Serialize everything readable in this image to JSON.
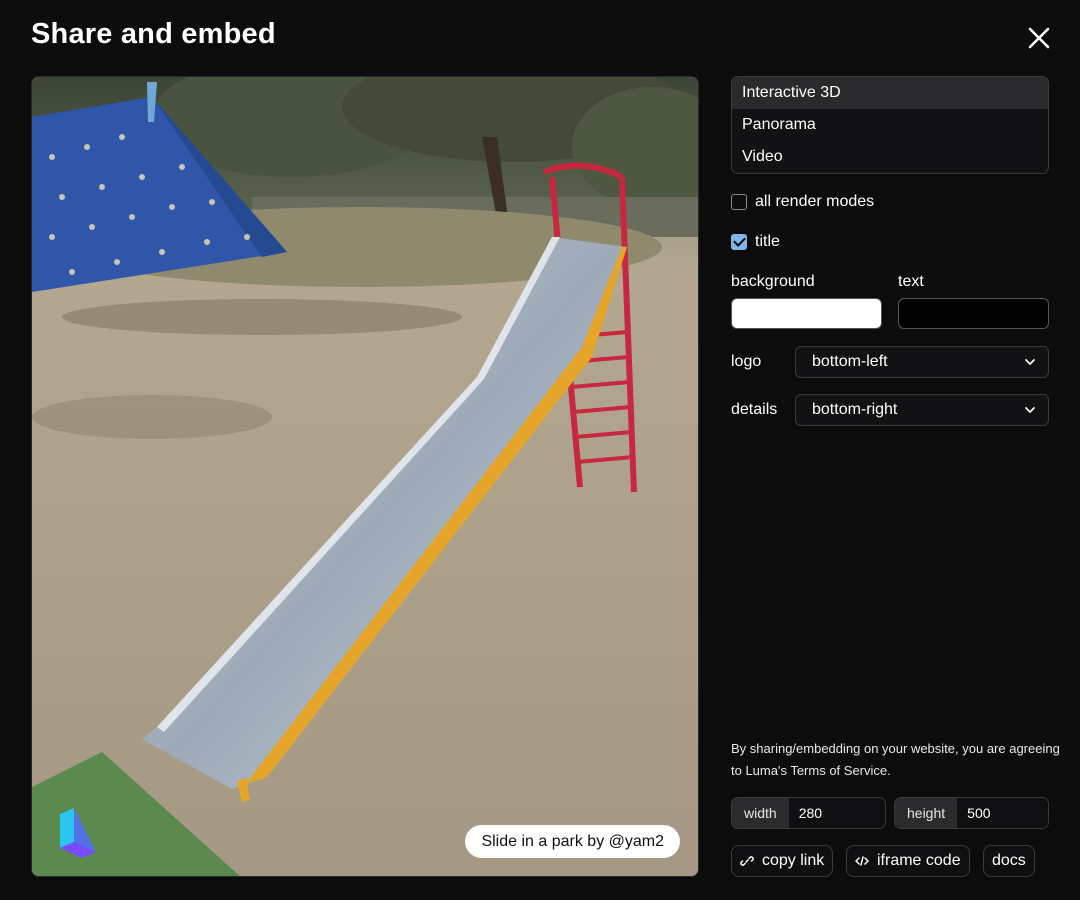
{
  "dialog": {
    "title": "Share and embed",
    "close_icon": "close-icon"
  },
  "preview": {
    "caption": "Slide in a park by @yam2",
    "logo_icon": "luma-logo-icon"
  },
  "render_modes": {
    "items": [
      {
        "label": "Interactive 3D",
        "active": true
      },
      {
        "label": "Panorama",
        "active": false
      },
      {
        "label": "Video",
        "active": false
      }
    ]
  },
  "options": {
    "all_render_modes": {
      "label": "all render modes",
      "checked": false
    },
    "title": {
      "label": "title",
      "checked": true
    },
    "background_label": "background",
    "text_label": "text",
    "background_color": "#ffffff",
    "text_color": "#000000",
    "logo_label": "logo",
    "logo_value": "bottom-left",
    "details_label": "details",
    "details_value": "bottom-right"
  },
  "terms": "By sharing/embedding on your website, you are agreeing to Luma's Terms of Service.",
  "dimensions": {
    "width_label": "width",
    "width_value": "280",
    "height_label": "height",
    "height_value": "500"
  },
  "actions": {
    "copy_link": "copy link",
    "iframe_code": "iframe code",
    "docs": "docs"
  }
}
